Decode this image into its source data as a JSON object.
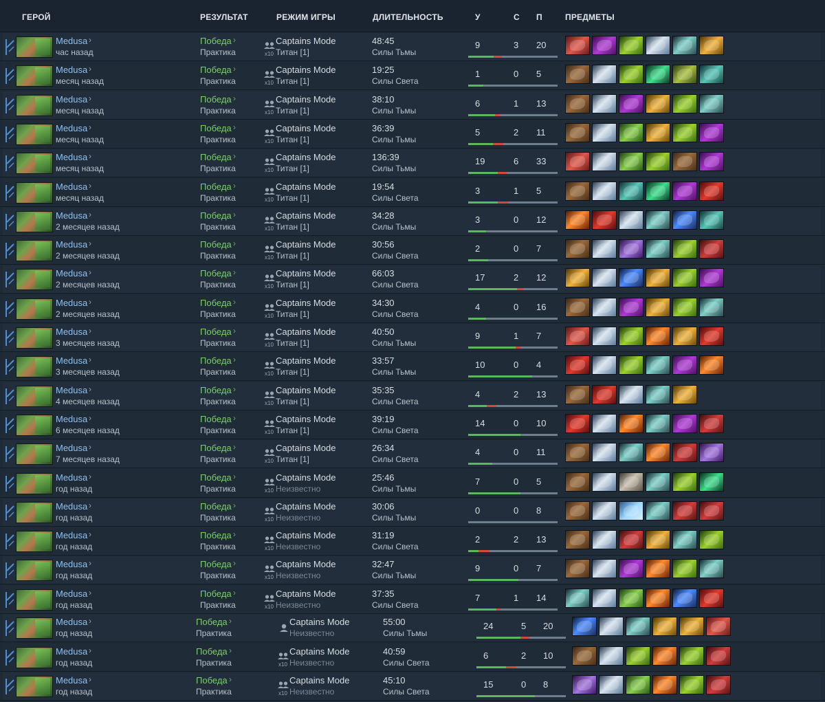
{
  "header": {
    "hero": "ГЕРОЙ",
    "result": "РЕЗУЛЬТАТ",
    "mode": "РЕЖИМ ИГРЫ",
    "duration": "ДЛИТЕЛЬНОСТЬ",
    "kills": "У",
    "deaths": "С",
    "assists": "П",
    "items": "ПРЕДМЕТЫ"
  },
  "chevron": "›",
  "party_icon": "party-x10-icon",
  "solo_icon": "solo-icon",
  "matches": [
    {
      "hero": "Medusa",
      "time": "час назад",
      "result": "Победа",
      "type": "Практика",
      "mode": "Captains Mode",
      "party": "x10",
      "skill": "Титан [1]",
      "duration": "48:45",
      "side": "Силы Тьмы",
      "k": "9",
      "d": "3",
      "a": "20",
      "items": [
        "daedalus",
        "dagon",
        "butterfly",
        "manta",
        "eye",
        "mjollnir"
      ]
    },
    {
      "hero": "Medusa",
      "time": "месяц назад",
      "result": "Победа",
      "type": "Практика",
      "mode": "Captains Mode",
      "party": "x10",
      "skill": "Титан [1]",
      "duration": "19:25",
      "side": "Силы Света",
      "k": "1",
      "d": "0",
      "a": "5",
      "items": [
        "treads",
        "manta",
        "butterfly",
        "gem",
        "sny",
        "linken"
      ]
    },
    {
      "hero": "Medusa",
      "time": "месяц назад",
      "result": "Победа",
      "type": "Практика",
      "mode": "Captains Mode",
      "party": "x10",
      "skill": "Титан [1]",
      "duration": "38:10",
      "side": "Силы Тьмы",
      "k": "6",
      "d": "1",
      "a": "13",
      "items": [
        "treads",
        "manta",
        "dagon",
        "mjollnir",
        "butterfly",
        "eye"
      ]
    },
    {
      "hero": "Medusa",
      "time": "месяц назад",
      "result": "Победа",
      "type": "Практика",
      "mode": "Captains Mode",
      "party": "x10",
      "skill": "Титан [1]",
      "duration": "36:39",
      "side": "Силы Тьмы",
      "k": "5",
      "d": "2",
      "a": "11",
      "items": [
        "treads",
        "manta",
        "yasha",
        "mjollnir",
        "butterfly",
        "dagon"
      ]
    },
    {
      "hero": "Medusa",
      "time": "месяц назад",
      "result": "Победа",
      "type": "Практика",
      "mode": "Captains Mode",
      "party": "x10",
      "skill": "Титан [1]",
      "duration": "136:39",
      "side": "Силы Тьмы",
      "k": "19",
      "d": "6",
      "a": "33",
      "items": [
        "daedalus",
        "manta",
        "yasha",
        "butterfly",
        "treads",
        "dagon"
      ]
    },
    {
      "hero": "Medusa",
      "time": "месяц назад",
      "result": "Победа",
      "type": "Практика",
      "mode": "Captains Mode",
      "party": "x10",
      "skill": "Титан [1]",
      "duration": "19:54",
      "side": "Силы Света",
      "k": "3",
      "d": "1",
      "a": "5",
      "items": [
        "treads",
        "manta",
        "linken",
        "gem",
        "dagon",
        "satanic"
      ]
    },
    {
      "hero": "Medusa",
      "time": "2 месяцев назад",
      "result": "Победа",
      "type": "Практика",
      "mode": "Captains Mode",
      "party": "x10",
      "skill": "Титан [1]",
      "duration": "34:28",
      "side": "Силы Тьмы",
      "k": "3",
      "d": "0",
      "a": "12",
      "items": [
        "radiance",
        "satanic",
        "manta",
        "eye",
        "orb",
        "linken"
      ]
    },
    {
      "hero": "Medusa",
      "time": "2 месяцев назад",
      "result": "Победа",
      "type": "Практика",
      "mode": "Captains Mode",
      "party": "x10",
      "skill": "Титан [1]",
      "duration": "30:56",
      "side": "Силы Света",
      "k": "2",
      "d": "0",
      "a": "7",
      "items": [
        "treads",
        "manta",
        "diffusal",
        "eye",
        "butterfly",
        "desolator"
      ]
    },
    {
      "hero": "Medusa",
      "time": "2 месяцев назад",
      "result": "Победа",
      "type": "Практика",
      "mode": "Captains Mode",
      "party": "x10",
      "skill": "Титан [1]",
      "duration": "66:03",
      "side": "Силы Света",
      "k": "17",
      "d": "2",
      "a": "12",
      "items": [
        "mjollnir",
        "manta",
        "orb",
        "mjollnir",
        "butterfly",
        "dagon"
      ]
    },
    {
      "hero": "Medusa",
      "time": "2 месяцев назад",
      "result": "Победа",
      "type": "Практика",
      "mode": "Captains Mode",
      "party": "x10",
      "skill": "Титан [1]",
      "duration": "34:30",
      "side": "Силы Света",
      "k": "4",
      "d": "0",
      "a": "16",
      "items": [
        "treads",
        "manta",
        "dagon",
        "mjollnir",
        "butterfly",
        "eye"
      ]
    },
    {
      "hero": "Medusa",
      "time": "3 месяцев назад",
      "result": "Победа",
      "type": "Практика",
      "mode": "Captains Mode",
      "party": "x10",
      "skill": "Титан [1]",
      "duration": "40:50",
      "side": "Силы Тьмы",
      "k": "9",
      "d": "1",
      "a": "7",
      "items": [
        "daedalus",
        "manta",
        "butterfly",
        "radiance",
        "mjollnir",
        "satanic"
      ]
    },
    {
      "hero": "Medusa",
      "time": "3 месяцев назад",
      "result": "Победа",
      "type": "Практика",
      "mode": "Captains Mode",
      "party": "x10",
      "skill": "Титан [1]",
      "duration": "33:57",
      "side": "Силы Тьмы",
      "k": "10",
      "d": "0",
      "a": "4",
      "items": [
        "satanic",
        "manta",
        "butterfly",
        "eye",
        "dagon",
        "radiance"
      ]
    },
    {
      "hero": "Medusa",
      "time": "4 месяцев назад",
      "result": "Победа",
      "type": "Практика",
      "mode": "Captains Mode",
      "party": "x10",
      "skill": "Титан [1]",
      "duration": "35:35",
      "side": "Силы Света",
      "k": "4",
      "d": "2",
      "a": "13",
      "items": [
        "treads",
        "satanic",
        "manta",
        "eye",
        "mjollnir"
      ]
    },
    {
      "hero": "Medusa",
      "time": "6 месяцев назад",
      "result": "Победа",
      "type": "Практика",
      "mode": "Captains Mode",
      "party": "x10",
      "skill": "Титан [1]",
      "duration": "39:19",
      "side": "Силы Света",
      "k": "14",
      "d": "0",
      "a": "10",
      "items": [
        "satanic",
        "manta",
        "radiance",
        "eye",
        "dagon",
        "desolator"
      ]
    },
    {
      "hero": "Medusa",
      "time": "7 месяцев назад",
      "result": "Победа",
      "type": "Практика",
      "mode": "Captains Mode",
      "party": "x10",
      "skill": "Титан [1]",
      "duration": "26:34",
      "side": "Силы Света",
      "k": "4",
      "d": "0",
      "a": "11",
      "items": [
        "treads",
        "manta",
        "eye",
        "radiance",
        "desolator",
        "diffusal"
      ]
    },
    {
      "hero": "Medusa",
      "time": "год назад",
      "result": "Победа",
      "type": "Практика",
      "mode": "Captains Mode",
      "party": "x10",
      "skill": "Неизвестно",
      "duration": "25:46",
      "side": "Силы Тьмы",
      "k": "7",
      "d": "0",
      "a": "5",
      "items": [
        "treads",
        "manta",
        "axe",
        "eye",
        "butterfly",
        "gem"
      ]
    },
    {
      "hero": "Medusa",
      "time": "год назад",
      "result": "Победа",
      "type": "Практика",
      "mode": "Captains Mode",
      "party": "x10",
      "skill": "Неизвестно",
      "duration": "30:06",
      "side": "Силы Тьмы",
      "k": "0",
      "d": "0",
      "a": "8",
      "items": [
        "treads",
        "manta",
        "skadi",
        "eye",
        "desolator",
        "desolator"
      ]
    },
    {
      "hero": "Medusa",
      "time": "год назад",
      "result": "Победа",
      "type": "Практика",
      "mode": "Captains Mode",
      "party": "x10",
      "skill": "Неизвестно",
      "duration": "31:19",
      "side": "Силы Света",
      "k": "2",
      "d": "2",
      "a": "13",
      "items": [
        "treads",
        "manta",
        "desolator",
        "mjollnir",
        "eye",
        "butterfly"
      ]
    },
    {
      "hero": "Medusa",
      "time": "год назад",
      "result": "Победа",
      "type": "Практика",
      "mode": "Captains Mode",
      "party": "x10",
      "skill": "Неизвестно",
      "duration": "32:47",
      "side": "Силы Тьмы",
      "k": "9",
      "d": "0",
      "a": "7",
      "items": [
        "treads",
        "manta",
        "dagon",
        "radiance",
        "butterfly",
        "eye"
      ]
    },
    {
      "hero": "Medusa",
      "time": "год назад",
      "result": "Победа",
      "type": "Практика",
      "mode": "Captains Mode",
      "party": "x10",
      "skill": "Неизвестно",
      "duration": "37:35",
      "side": "Силы Света",
      "k": "7",
      "d": "1",
      "a": "14",
      "items": [
        "eye",
        "manta",
        "yasha",
        "radiance",
        "orb",
        "satanic"
      ]
    },
    {
      "hero": "Medusa",
      "time": "год назад",
      "result": "Победа",
      "type": "Практика",
      "mode": "Captains Mode",
      "party": "solo",
      "skill": "Неизвестно",
      "duration": "55:00",
      "side": "Силы Тьмы",
      "k": "24",
      "d": "5",
      "a": "20",
      "items": [
        "orb",
        "manta",
        "eye",
        "mjollnir",
        "mjollnir",
        "daedalus"
      ]
    },
    {
      "hero": "Medusa",
      "time": "год назад",
      "result": "Победа",
      "type": "Практика",
      "mode": "Captains Mode",
      "party": "x10",
      "skill": "Неизвестно",
      "duration": "40:59",
      "side": "Силы Света",
      "k": "6",
      "d": "2",
      "a": "10",
      "items": [
        "treads",
        "manta",
        "butterfly",
        "radiance",
        "butterfly",
        "desolator"
      ]
    },
    {
      "hero": "Medusa",
      "time": "год назад",
      "result": "Победа",
      "type": "Практика",
      "mode": "Captains Mode",
      "party": "x10",
      "skill": "Неизвестно",
      "duration": "45:10",
      "side": "Силы Света",
      "k": "15",
      "d": "0",
      "a": "8",
      "items": [
        "diffusal",
        "manta",
        "yasha",
        "radiance",
        "butterfly",
        "desolator"
      ]
    }
  ]
}
